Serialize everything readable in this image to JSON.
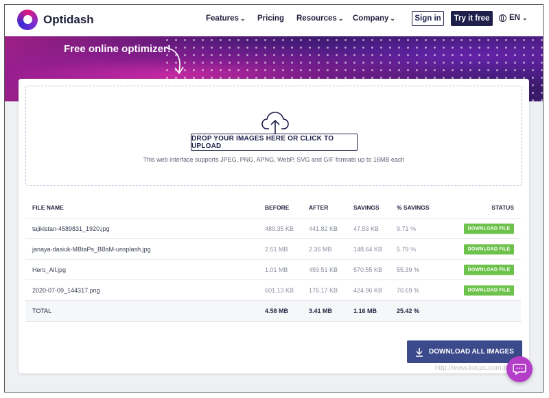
{
  "header": {
    "logo_text": "Optidash",
    "nav": [
      {
        "label": "Features",
        "has_dropdown": true
      },
      {
        "label": "Pricing",
        "has_dropdown": false
      },
      {
        "label": "Resources",
        "has_dropdown": true
      },
      {
        "label": "Company",
        "has_dropdown": true
      }
    ],
    "sign_in": "Sign in",
    "try_it": "Try it free",
    "lang": "EN"
  },
  "hero": {
    "title": "Free online optimizer!"
  },
  "dropzone": {
    "upload_label": "DROP YOUR IMAGES HERE OR CLICK TO UPLOAD",
    "support_text": "This web interface supports JPEG, PNG, APNG, WebP, SVG and GIF formats up to 16MB each"
  },
  "table": {
    "headers": {
      "file_name": "FILE NAME",
      "before": "BEFORE",
      "after": "AFTER",
      "savings": "SAVINGS",
      "pct_savings": "% SAVINGS",
      "status": "STATUS"
    },
    "rows": [
      {
        "name": "tajikistan-4589831_1920.jpg",
        "before": "489.35 KB",
        "after": "441.82 KB",
        "savings": "47.53 KB",
        "pct": "9.71 %",
        "status": "DOWNLOAD FILE"
      },
      {
        "name": "janaya-dasiuk-MBtaPs_BBsM-unsplash.jpg",
        "before": "2.51 MB",
        "after": "2.36 MB",
        "savings": "148.64 KB",
        "pct": "5.79 %",
        "status": "DOWNLOAD FILE"
      },
      {
        "name": "Hero_All.jpg",
        "before": "1.01 MB",
        "after": "459.51 KB",
        "savings": "570.55 KB",
        "pct": "55.39 %",
        "status": "DOWNLOAD FILE"
      },
      {
        "name": "2020-07-09_144317.png",
        "before": "601.13 KB",
        "after": "176.17 KB",
        "savings": "424.96 KB",
        "pct": "70.69 %",
        "status": "DOWNLOAD FILE"
      }
    ],
    "total": {
      "label": "TOTAL",
      "before": "4.58 MB",
      "after": "3.41 MB",
      "savings": "1.16 MB",
      "pct": "25.42 %"
    }
  },
  "download_all": "DOWNLOAD ALL IMAGES",
  "watermark": "http://www.kocpc.com.tw",
  "colors": {
    "brand_dark": "#1e1f4a",
    "download_green": "#6cc24a",
    "chat_purple": "#b43ec8",
    "download_all_bg": "#3b4a8a"
  },
  "icons": {
    "logo": "optidash-logo-icon",
    "globe": "globe-icon",
    "upload": "cloud-upload-icon",
    "download": "download-icon",
    "chat": "chat-bubble-icon"
  }
}
